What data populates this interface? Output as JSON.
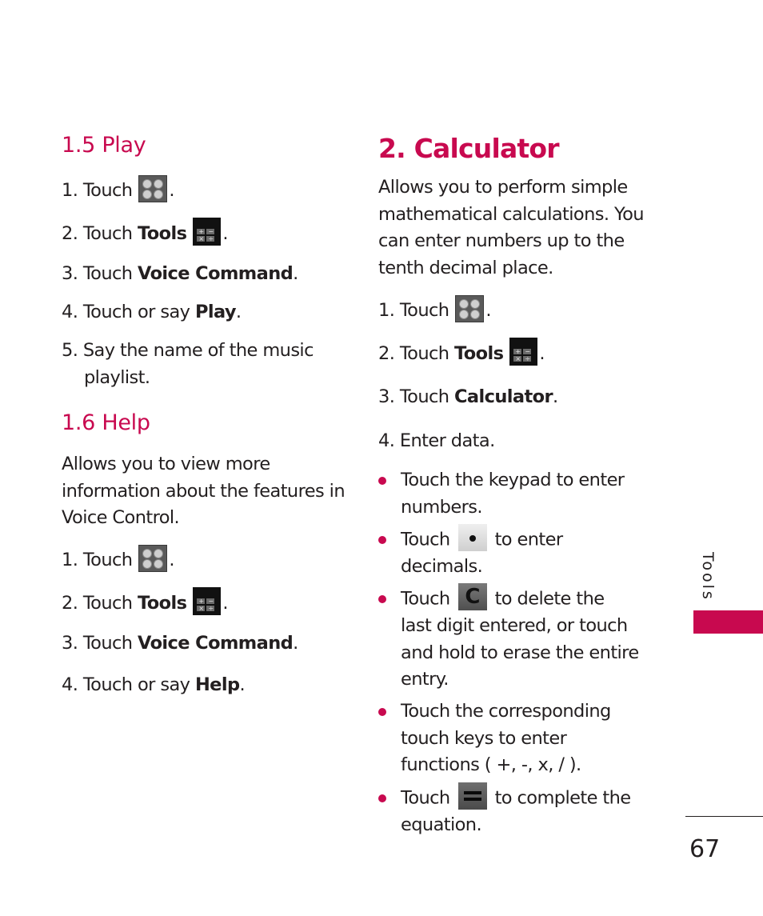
{
  "left_column": {
    "section_play": {
      "heading": "1.5 Play",
      "steps": [
        {
          "num": "1.",
          "text": "Touch",
          "icon": "menu-icon",
          "suffix": "."
        },
        {
          "num": "2.",
          "text": "Touch",
          "bold": "Tools",
          "icon": "tools-icon",
          "suffix": "."
        },
        {
          "num": "3.",
          "text": "Touch",
          "bold": "Voice Command",
          "suffix": "."
        },
        {
          "num": "4.",
          "text": "Touch or say",
          "bold": "Play",
          "suffix": "."
        },
        {
          "num": "5.",
          "text_line1": "Say the name of the music",
          "text_line2": "playlist."
        }
      ]
    },
    "section_help": {
      "heading": "1.6 Help",
      "intro_lines": [
        "Allows you to view more",
        "information about the features in",
        "Voice Control."
      ],
      "steps": [
        {
          "num": "1.",
          "text": "Touch",
          "icon": "menu-icon",
          "suffix": "."
        },
        {
          "num": "2.",
          "text": "Touch",
          "bold": "Tools",
          "icon": "tools-icon",
          "suffix": "."
        },
        {
          "num": "3.",
          "text": "Touch",
          "bold": "Voice Command",
          "suffix": "."
        },
        {
          "num": "4.",
          "text": "Touch or say",
          "bold": "Help",
          "suffix": "."
        }
      ]
    }
  },
  "right_column": {
    "heading": "2. Calculator",
    "intro_lines": [
      "Allows you to perform simple",
      "mathematical calculations. You",
      "can enter numbers up to the",
      "tenth decimal place."
    ],
    "steps": [
      {
        "num": "1.",
        "text": "Touch",
        "icon": "menu-icon",
        "suffix": "."
      },
      {
        "num": "2.",
        "text": "Touch",
        "bold": "Tools",
        "icon": "tools-icon",
        "suffix": "."
      },
      {
        "num": "3.",
        "text": "Touch",
        "bold": "Calculator",
        "suffix": "."
      },
      {
        "num": "4.",
        "text": "Enter data."
      }
    ],
    "bullets": [
      {
        "lines": [
          "Touch the keypad to enter",
          "numbers."
        ]
      },
      {
        "before": "Touch",
        "icon": "decimal-key-icon",
        "after": "to enter",
        "lines": [
          "decimals."
        ]
      },
      {
        "before": "Touch",
        "icon": "clear-key-icon",
        "icon_label": "C",
        "after": "to delete the",
        "lines": [
          "last digit entered, or touch",
          "and hold to erase the entire",
          "entry."
        ]
      },
      {
        "lines": [
          "Touch the corresponding",
          "touch keys to enter",
          "functions ( +, -, x, / )."
        ]
      },
      {
        "before": "Touch",
        "icon": "equals-key-icon",
        "after": "to complete the",
        "lines": [
          "equation."
        ]
      }
    ]
  },
  "side_tab": {
    "label": "Tools",
    "color": "#c8094f"
  },
  "footer": {
    "page_number": "67"
  },
  "colors": {
    "accent": "#c8094f",
    "text": "#231f20"
  }
}
